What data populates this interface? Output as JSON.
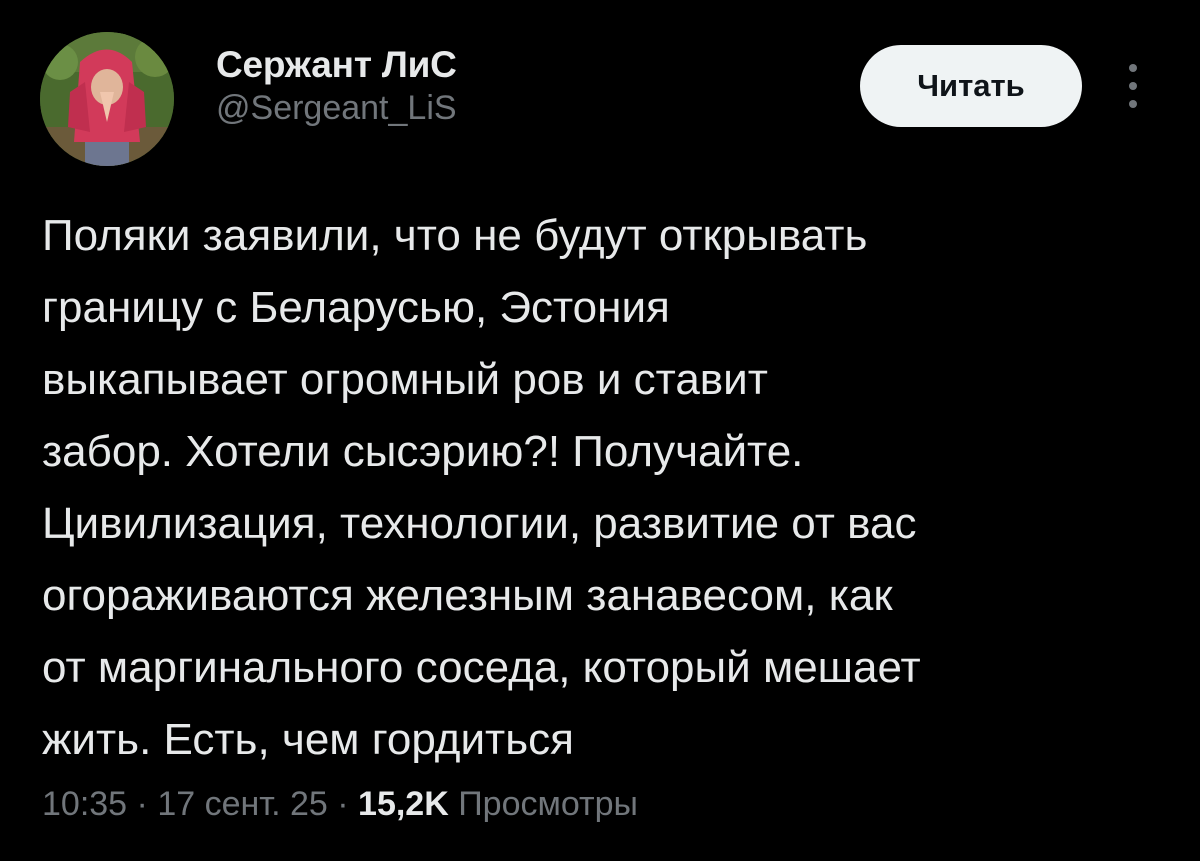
{
  "author": {
    "display_name": "Сержант ЛиС",
    "handle": "@Sergeant_LiS"
  },
  "follow_button": {
    "label": "Читать"
  },
  "more_menu": {
    "icon": "more-vertical-icon"
  },
  "tweet": {
    "text_lines": [
      "Поляки заявили, что не будут открывать",
      "границу с Беларусью, Эстония",
      "выкапывает огромный ров и ставит",
      "забор. Хотели сысэрию?! Получайте.",
      "Цивилизация, технологии, развитие от вас",
      "огораживаются железным занавесом, как",
      "от маргинального соседа, который мешает",
      "жить. Есть, чем гордиться"
    ]
  },
  "meta": {
    "time": "10:35",
    "separator": "·",
    "date": "17 сент. 25",
    "views_count": "15,2K",
    "views_label": "Просмотры"
  },
  "colors": {
    "background": "#000000",
    "primary_text": "#e7e9ea",
    "secondary_text": "#71767b",
    "button_bg": "#eff3f4"
  }
}
